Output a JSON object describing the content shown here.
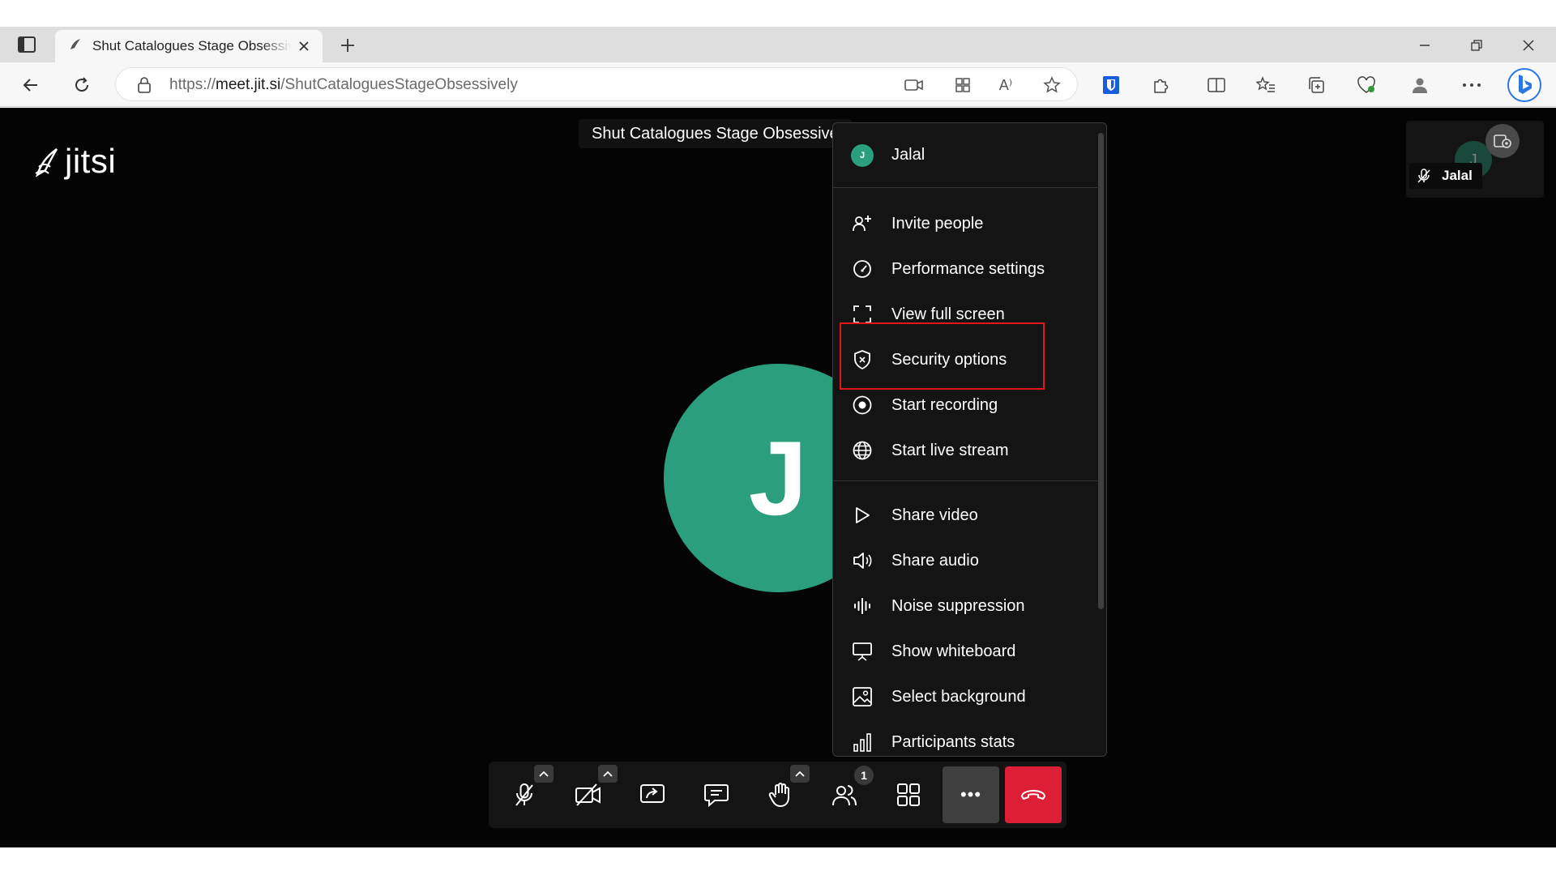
{
  "browser": {
    "tab_title": "Shut Catalogues Stage Obsessively",
    "url_prefix": "https://",
    "url_host": "meet.jit.si",
    "url_path": "/ShutCataloguesStageObsessively",
    "read_aloud_label": "A⁾"
  },
  "meeting": {
    "logo_text": "jitsi",
    "title": "Shut Catalogues Stage Obsessive",
    "avatar_initial": "J",
    "thumbnail_initial": "J",
    "thumbnail_name": "Jalal"
  },
  "menu": {
    "user_initial": "J",
    "user_name": "Jalal",
    "items": [
      {
        "label": "Invite people",
        "icon": "invite-people-icon"
      },
      {
        "label": "Performance settings",
        "icon": "gauge-icon"
      },
      {
        "label": "View full screen",
        "icon": "fullscreen-icon"
      },
      {
        "label": "Security options",
        "icon": "shield-icon"
      },
      {
        "label": "Start recording",
        "icon": "record-icon"
      },
      {
        "label": "Start live stream",
        "icon": "globe-icon"
      },
      {
        "label": "Share video",
        "icon": "play-icon"
      },
      {
        "label": "Share audio",
        "icon": "speaker-icon"
      },
      {
        "label": "Noise suppression",
        "icon": "noise-suppression-icon"
      },
      {
        "label": "Show whiteboard",
        "icon": "whiteboard-icon"
      },
      {
        "label": "Select background",
        "icon": "image-icon"
      },
      {
        "label": "Participants stats",
        "icon": "bar-chart-icon"
      }
    ]
  },
  "toolbar": {
    "participants_count": "1",
    "more_label": "•••"
  },
  "colors": {
    "accent_green": "#2b9f7d",
    "leave_red": "#dc1e36",
    "highlight_red": "#e0161c"
  }
}
